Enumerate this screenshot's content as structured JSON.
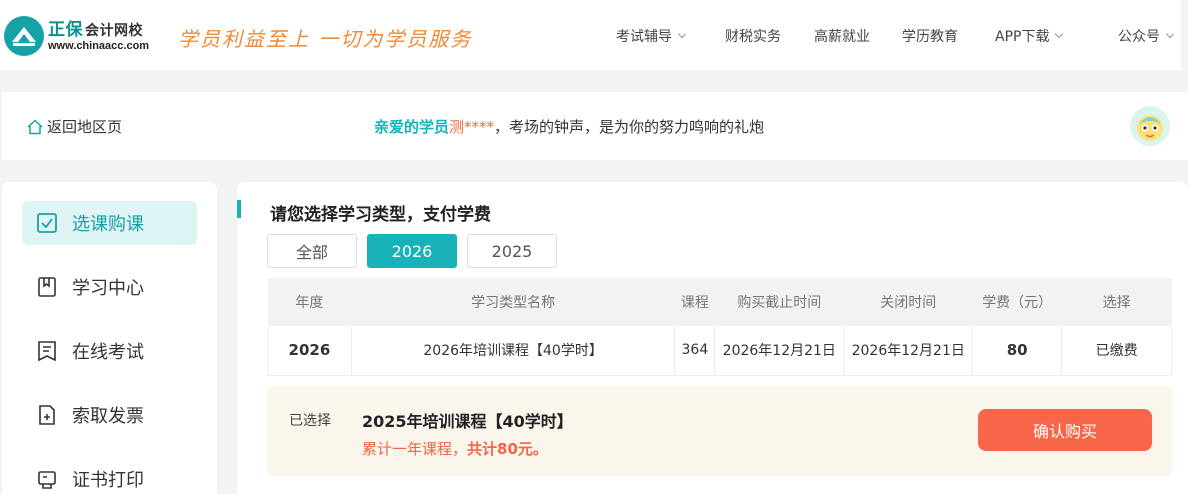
{
  "header": {
    "brand_cn": "正保",
    "brand_sub": "会计网校",
    "brand_url": "www.chinaacc.com",
    "slogan": "学员利益至上  一切为学员服务",
    "nav": [
      {
        "label": "考试辅导",
        "dropdown": true
      },
      {
        "label": "财税实务",
        "dropdown": false
      },
      {
        "label": "高薪就业",
        "dropdown": false
      },
      {
        "label": "学历教育",
        "dropdown": false
      },
      {
        "label": "APP下载",
        "dropdown": true
      },
      {
        "label": "公众号",
        "dropdown": true
      }
    ]
  },
  "region": {
    "back_label": "返回地区页",
    "greeting_a": "亲爱的学员",
    "greeting_b": "测****",
    "greeting_c": "，考场的钟声，是为你的努力鸣响的礼炮"
  },
  "sidebar": {
    "items": [
      {
        "label": "选课购课",
        "icon": "checkbox-icon",
        "active": true
      },
      {
        "label": "学习中心",
        "icon": "bookmark-icon",
        "active": false
      },
      {
        "label": "在线考试",
        "icon": "exam-icon",
        "active": false
      },
      {
        "label": "索取发票",
        "icon": "invoice-icon",
        "active": false
      },
      {
        "label": "证书打印",
        "icon": "printer-icon",
        "active": false
      }
    ]
  },
  "main": {
    "title": "请您选择学习类型，支付学费",
    "tabs": [
      {
        "label": "全部",
        "active": false
      },
      {
        "label": "2026",
        "active": true
      },
      {
        "label": "2025",
        "active": false
      }
    ],
    "table": {
      "headers": [
        "年度",
        "学习类型名称",
        "课程",
        "购买截止时间",
        "关闭时间",
        "学费（元）",
        "选择"
      ],
      "rows": [
        {
          "year": "2026",
          "name": "2026年培训课程【40学时】",
          "courses": "364",
          "deadline": "2026年12月21日",
          "close": "2026年12月21日",
          "fee": "80",
          "status": "已缴费"
        }
      ]
    },
    "summary": {
      "selected_label": "已选择",
      "selected_name": "2025年培训课程【40学时】",
      "total_prefix": "累计一年课程，",
      "total_amount": "共计80元。",
      "confirm_label": "确认购买"
    }
  },
  "colors": {
    "accent": "#17b3b9",
    "orange": "#f76648",
    "slogan": "#f08a35"
  }
}
